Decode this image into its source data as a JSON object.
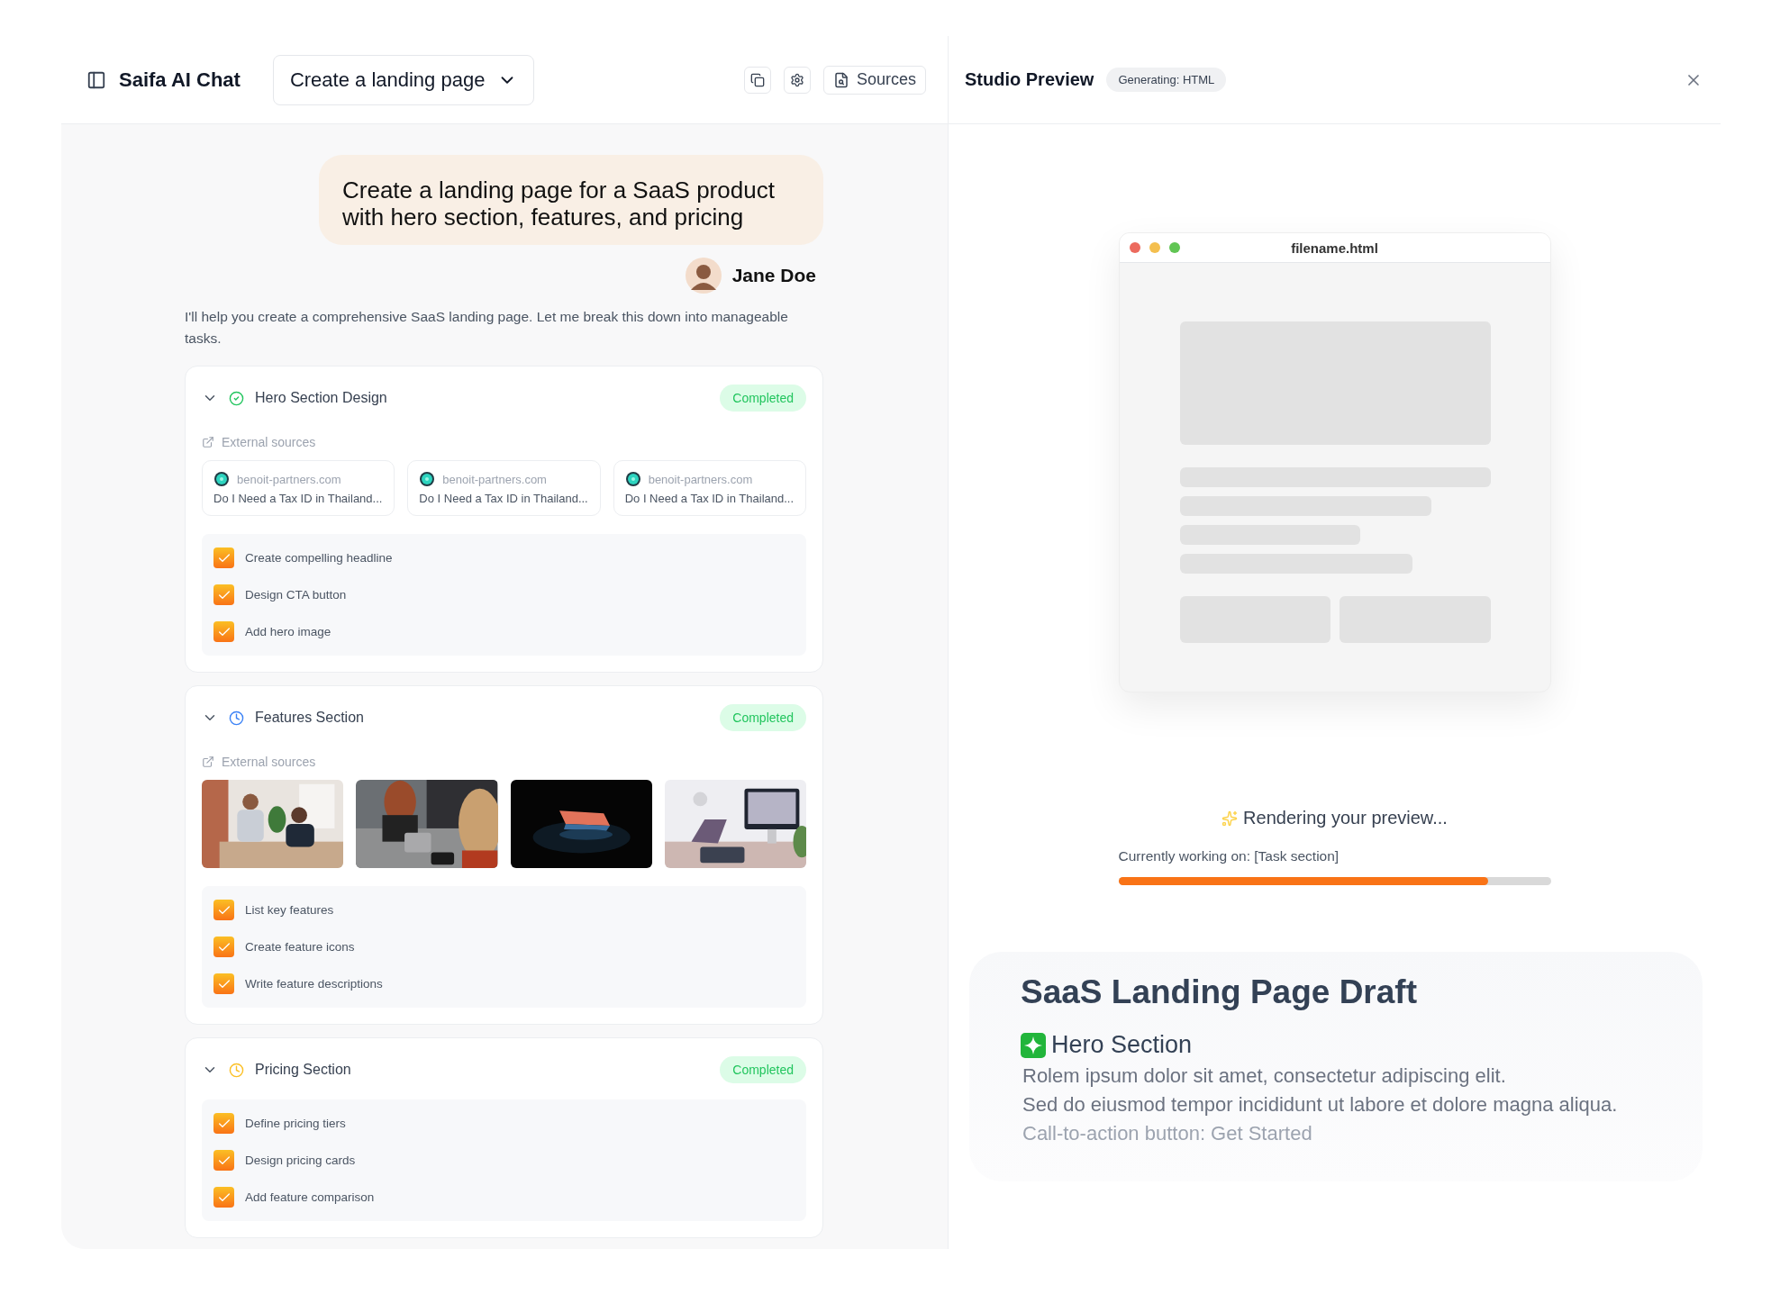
{
  "header": {
    "title": "Saifa AI Chat",
    "mode": "Create a landing page",
    "sources_button": "Sources"
  },
  "preview_header": {
    "title": "Studio Preview",
    "badge": "Generating: HTML"
  },
  "chat": {
    "user_message": "Create a landing page for a SaaS product with hero section, features, and pricing",
    "user_name": "Jane Doe",
    "reply": "I'll help you create a comprehensive SaaS landing page. Let me break this down into manageable tasks."
  },
  "tasks": [
    {
      "title": "Hero Section Design",
      "kind": "done",
      "badge": "Completed",
      "expanded": true,
      "sources_label": "External sources",
      "sources": [
        {
          "kind": "link",
          "domain": "benoit-partners.com",
          "title": "Do I Need a Tax ID in Thailand..."
        },
        {
          "kind": "link",
          "domain": "benoit-partners.com",
          "title": "Do I Need a Tax ID in Thailand..."
        },
        {
          "kind": "link",
          "domain": "benoit-partners.com",
          "title": "Do I Need a Tax ID in Thailand..."
        }
      ],
      "items": [
        {
          "label": "Create compelling headline",
          "checked": true
        },
        {
          "label": "Design CTA button",
          "checked": true
        },
        {
          "label": "Add hero image",
          "checked": true
        }
      ]
    },
    {
      "title": "Features Section",
      "kind": "in_progress",
      "badge": "Completed",
      "expanded": true,
      "sources_label": "External sources",
      "sources": [
        {
          "kind": "picture"
        },
        {
          "kind": "picture"
        },
        {
          "kind": "picture"
        },
        {
          "kind": "picture"
        }
      ],
      "items": [
        {
          "label": "List key features",
          "checked": true
        },
        {
          "label": "Create feature icons",
          "checked": true
        },
        {
          "label": "Write feature descriptions",
          "checked": true
        }
      ]
    },
    {
      "title": "Pricing Section",
      "kind": "pending",
      "badge": "Completed",
      "expanded": true,
      "items": [
        {
          "label": "Define pricing tiers",
          "checked": true
        },
        {
          "label": "Design pricing cards",
          "checked": true
        },
        {
          "label": "Add feature comparison",
          "checked": true
        }
      ]
    }
  ],
  "preview": {
    "filename": "filename.html",
    "status": "Rendering your preview...",
    "working_on": "Currently working on: [Task section]",
    "progress": {
      "level": 0.855
    }
  },
  "draft": {
    "title": "SaaS Landing Page Draft",
    "section_title": "Hero Section",
    "lines": [
      "Rolem ipsum dolor sit amet, consectetur adipiscing elit.",
      "Sed do eiusmod tempor incididunt ut labore et dolore magna aliqua."
    ],
    "note": "Call-to-action button: Get Started"
  }
}
